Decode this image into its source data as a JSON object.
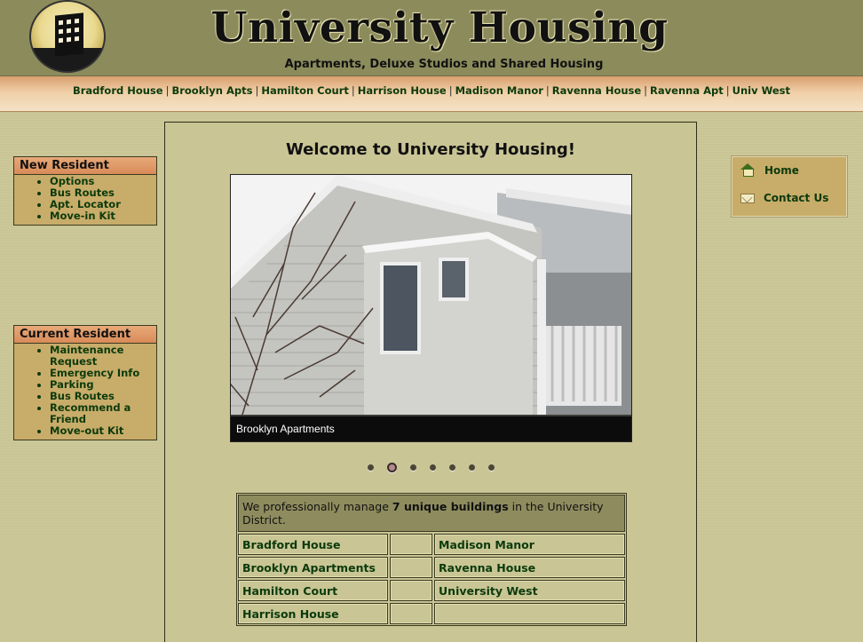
{
  "header": {
    "title": "University Housing",
    "subtitle": "Apartments, Deluxe Studios and Shared Housing",
    "logo_icon": "building-logo-icon"
  },
  "nav": {
    "links": [
      "Bradford House",
      "Brooklyn Apts",
      "Hamilton Court",
      "Harrison House",
      "Madison Manor",
      "Ravenna House",
      "Ravenna Apt",
      "Univ West"
    ],
    "separator": "|"
  },
  "new_resident": {
    "heading": "New Resident",
    "items": [
      "Options",
      "Bus Routes",
      "Apt. Locator",
      "Move-in Kit"
    ]
  },
  "current_resident": {
    "heading": "Current Resident",
    "items": [
      "Maintenance Request",
      "Emergency Info",
      "Parking",
      "Bus Routes",
      "Recommend a Friend",
      "Move-out Kit"
    ]
  },
  "quick_links": {
    "home": "Home",
    "contact": "Contact Us",
    "home_icon": "home-icon",
    "contact_icon": "envelope-icon"
  },
  "main": {
    "welcome": "Welcome to University Housing!",
    "slideshow": {
      "caption": "Brooklyn Apartments",
      "slide_count": 7,
      "active_index": 1
    },
    "buildings": {
      "intro_prefix": "We professionally manage ",
      "intro_bold": "7 unique buildings",
      "intro_suffix": " in the University District.",
      "rows": [
        [
          "Bradford House",
          "",
          "Madison Manor"
        ],
        [
          "Brooklyn Apartments",
          "",
          "Ravenna House"
        ],
        [
          "Hamilton Court",
          "",
          "University West"
        ],
        [
          "Harrison House",
          "",
          ""
        ]
      ]
    }
  },
  "colors": {
    "page_bg": "#c9c595",
    "header_bg": "#8b8b5c",
    "link_green": "#0b3a0b",
    "box_tan": "#c8ac6a",
    "box_header_orange": "#d98b59"
  }
}
